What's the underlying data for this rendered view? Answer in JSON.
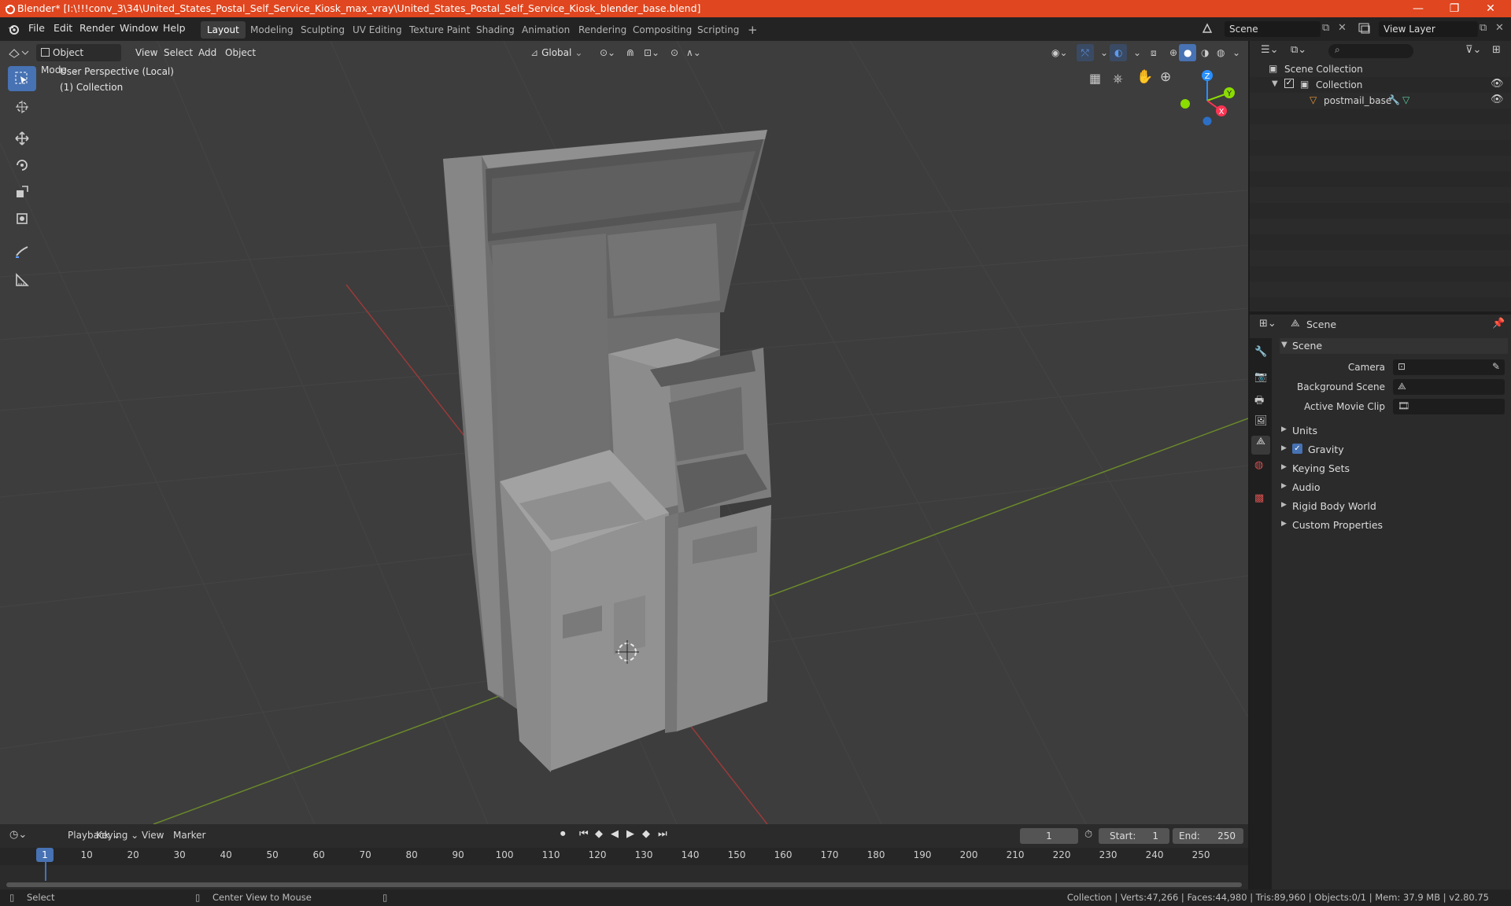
{
  "window": {
    "title": "Blender* [I:\\!!!conv_3\\34\\United_States_Postal_Self_Service_Kiosk_max_vray\\United_States_Postal_Self_Service_Kiosk_blender_base.blend]",
    "min": "—",
    "max": "❐",
    "close": "✕"
  },
  "menubar": {
    "items": [
      "File",
      "Edit",
      "Render",
      "Window",
      "Help"
    ]
  },
  "workspaces": {
    "tabs": [
      "Layout",
      "Modeling",
      "Sculpting",
      "UV Editing",
      "Texture Paint",
      "Shading",
      "Animation",
      "Rendering",
      "Compositing",
      "Scripting"
    ],
    "add": "+"
  },
  "scene_selector": {
    "value": "Scene"
  },
  "view_layer": {
    "value": "View Layer"
  },
  "viewport_header": {
    "mode": "Object Mode",
    "view": "View",
    "select": "Select",
    "add": "Add",
    "object": "Object",
    "orientation": "Global"
  },
  "viewport": {
    "perspective_label": "User Perspective (Local)",
    "collection_label": "(1) Collection",
    "gizmo": {
      "x": "X",
      "y": "Y",
      "z": "Z"
    }
  },
  "outliner": {
    "root": "Scene Collection",
    "collection": "Collection",
    "object": "postmail_base"
  },
  "properties": {
    "header": "Scene",
    "panel": "Scene",
    "camera_label": "Camera",
    "background_scene_label": "Background Scene",
    "active_movie_clip_label": "Active Movie Clip",
    "subpanels": [
      "Units",
      "Gravity",
      "Keying Sets",
      "Audio",
      "Rigid Body World",
      "Custom Properties"
    ]
  },
  "timeline": {
    "playback": "Playback",
    "keying": "Keying",
    "view": "View",
    "marker": "Marker",
    "current_frame": "1",
    "start_label": "Start:",
    "start_value": "1",
    "end_label": "End:",
    "end_value": "250",
    "ruler": [
      "1",
      "10",
      "20",
      "30",
      "40",
      "50",
      "60",
      "70",
      "80",
      "90",
      "100",
      "110",
      "120",
      "130",
      "140",
      "150",
      "160",
      "170",
      "180",
      "190",
      "200",
      "210",
      "220",
      "230",
      "240",
      "250"
    ]
  },
  "statusbar": {
    "select": "Select",
    "center_view": "Center View to Mouse",
    "stats": "Collection | Verts:47,266 | Faces:44,980 | Tris:89,960 | Objects:0/1 | Mem: 37.9 MB | v2.80.75"
  },
  "colors": {
    "titlebar": "#e0461f",
    "accent": "#4772b3",
    "axis_x": "#ff3352",
    "axis_y": "#8bdc00",
    "axis_z": "#2890ff"
  }
}
